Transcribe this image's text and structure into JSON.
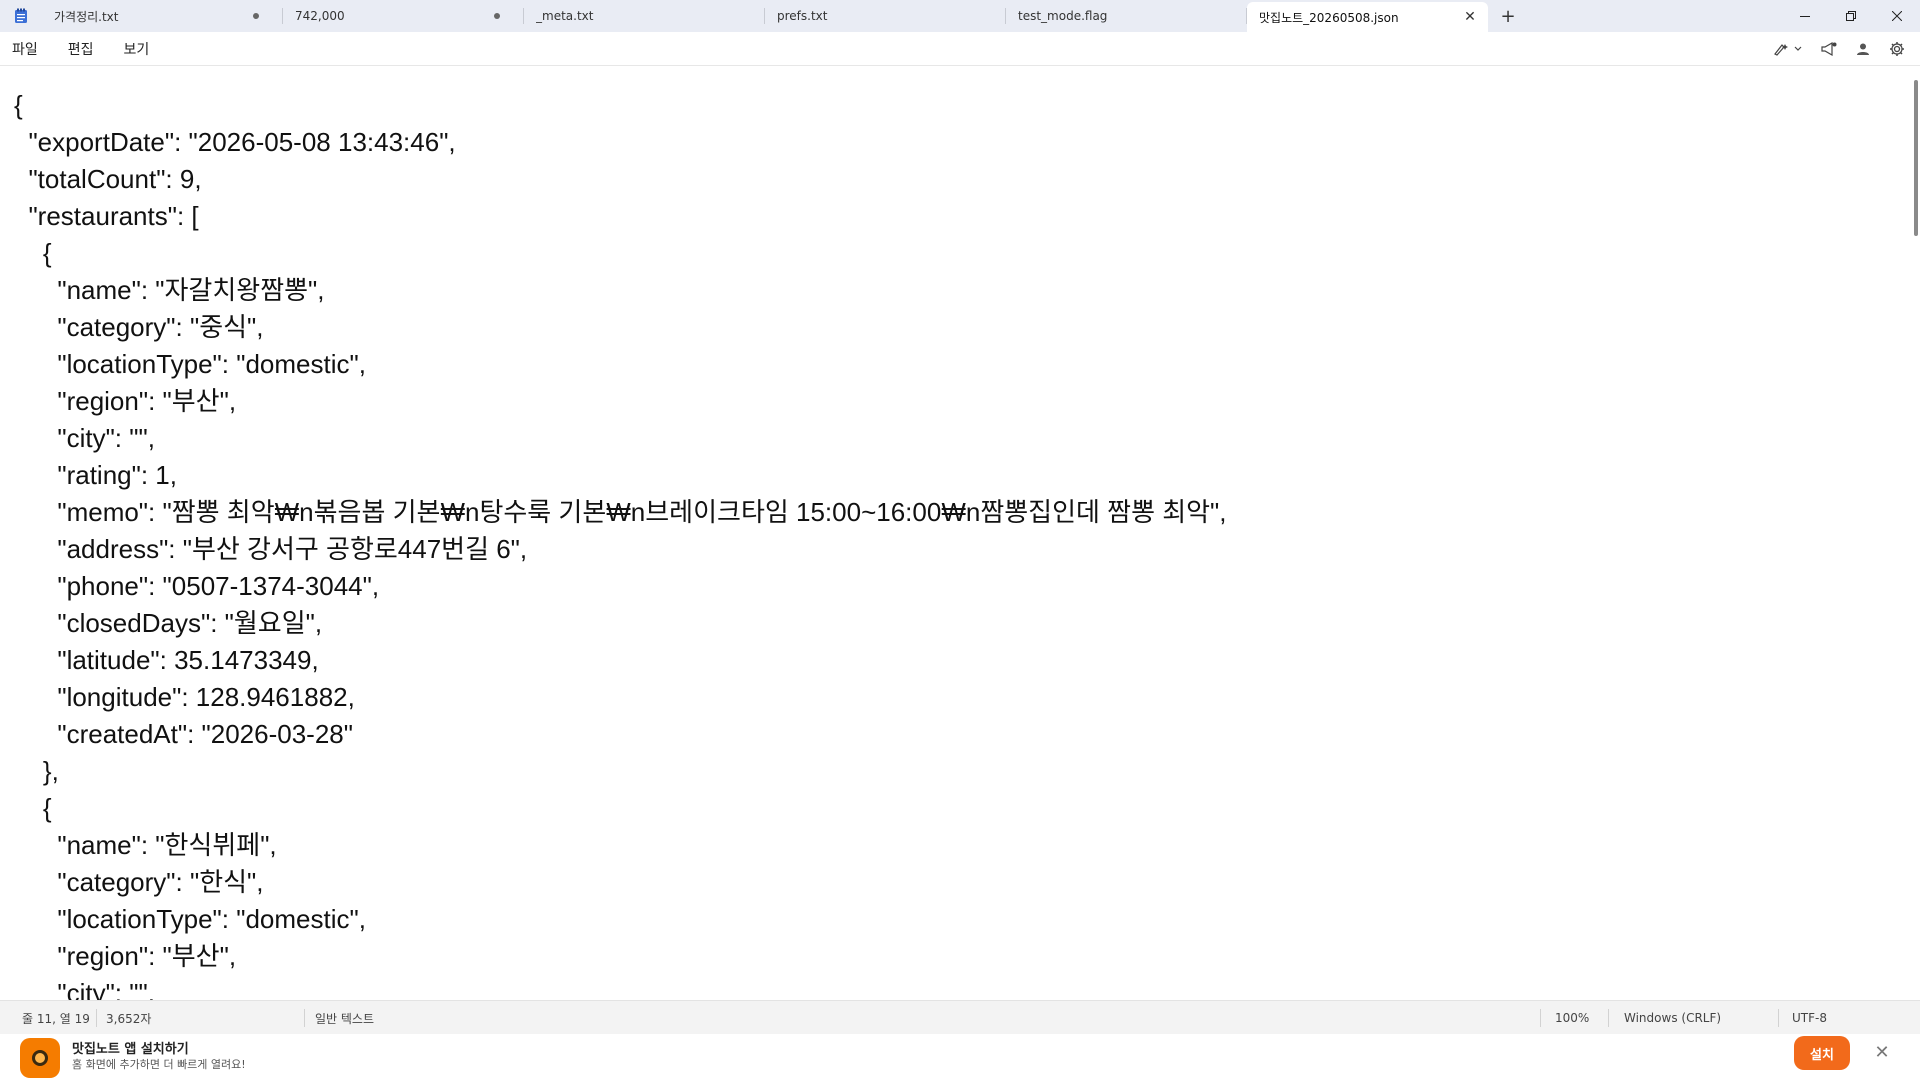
{
  "tabs": [
    {
      "label": "가격정리.txt",
      "dirty": true,
      "active": false
    },
    {
      "label": "742,000",
      "dirty": true,
      "active": false
    },
    {
      "label": "_meta.txt",
      "dirty": false,
      "active": false
    },
    {
      "label": "prefs.txt",
      "dirty": false,
      "active": false
    },
    {
      "label": "test_mode.flag",
      "dirty": false,
      "active": false
    },
    {
      "label": "맛집노트_20260508.json",
      "dirty": false,
      "active": true
    }
  ],
  "new_tab_label": "+",
  "window_controls": {
    "minimize": "—",
    "restore": "❐",
    "close": "✕"
  },
  "menu": [
    "파일",
    "편집",
    "보기"
  ],
  "editor_lines": [
    "{",
    "  \"exportDate\": \"2026-05-08 13:43:46\",",
    "  \"totalCount\": 9,",
    "  \"restaurants\": [",
    "    {",
    "      \"name\": \"자갈치왕짬뽕\",",
    "      \"category\": \"중식\",",
    "      \"locationType\": \"domestic\",",
    "      \"region\": \"부산\",",
    "      \"city\": \"\",",
    "      \"rating\": 1,",
    "      \"memo\": \"짬뽕 최악₩n볶음봅 기본₩n탕수룩 기본₩n브레이크타임 15:00~16:00₩n짬뽕집인데 짬뽕 최악\",",
    "      \"address\": \"부산 강서구 공항로447번길 6\",",
    "      \"phone\": \"0507-1374-3044\",",
    "      \"closedDays\": \"월요일\",",
    "      \"latitude\": 35.1473349,",
    "      \"longitude\": 128.9461882,",
    "      \"createdAt\": \"2026-03-28\"",
    "    },",
    "    {",
    "      \"name\": \"한식뷔페\",",
    "      \"category\": \"한식\",",
    "      \"locationType\": \"domestic\",",
    "      \"region\": \"부산\",",
    "      \"city\": \"\","
  ],
  "status": {
    "position": "줄 11, 열 19",
    "char_count": "3,652자",
    "file_type": "일반 텍스트",
    "zoom": "100%",
    "line_ending": "Windows (CRLF)",
    "encoding": "UTF-8"
  },
  "banner": {
    "title": "맛집노트 앱 설치하기",
    "subtitle": "홈 화면에 추가하면 더 빠르게 열려요!",
    "install_label": "설치",
    "close_label": "✕"
  }
}
